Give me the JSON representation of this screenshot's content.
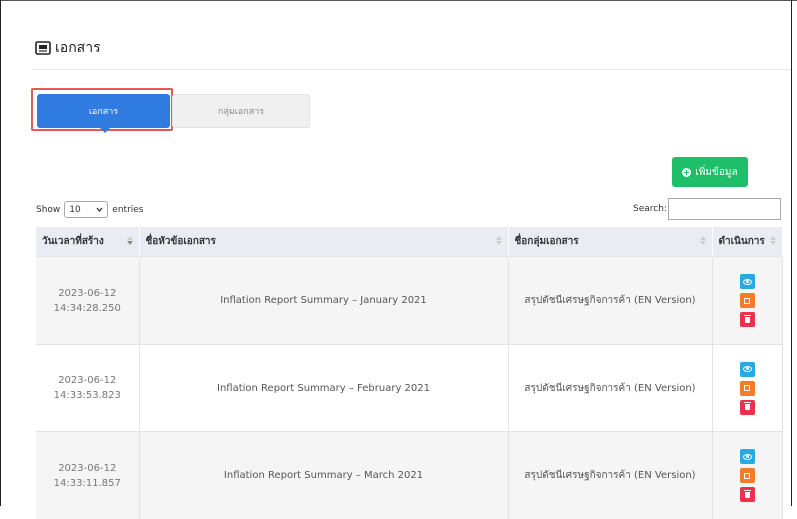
{
  "page": {
    "title": "เอกสาร",
    "title_icon": "document-image-icon"
  },
  "tabs": [
    {
      "label": "เอกสาร",
      "active": true
    },
    {
      "label": "กลุ่มเอกสาร",
      "active": false
    }
  ],
  "toolbar": {
    "add_label": "เพิ่มข้อมูล",
    "show_prefix": "Show",
    "entries_value": "10",
    "entries_suffix": "entries",
    "search_label": "Search:",
    "search_value": ""
  },
  "table": {
    "columns": [
      "วันเวลาที่สร้าง",
      "ชื่อหัวข้อเอกสาร",
      "ชื่อกลุ่มเอกสาร",
      "ดำเนินการ"
    ],
    "rows": [
      {
        "date": "2023-06-12",
        "time": "14:34:28.250",
        "title": "Inflation Report Summary – January 2021",
        "group": "สรุปดัชนีเศรษฐกิจการค้า (EN Version)"
      },
      {
        "date": "2023-06-12",
        "time": "14:33:53.823",
        "title": "Inflation Report Summary – February 2021",
        "group": "สรุปดัชนีเศรษฐกิจการค้า (EN Version)"
      },
      {
        "date": "2023-06-12",
        "time": "14:33:11.857",
        "title": "Inflation Report Summary – March 2021",
        "group": "สรุปดัชนีเศรษฐกิจการค้า (EN Version)"
      }
    ]
  },
  "colors": {
    "primary": "#2f7be0",
    "success": "#1fbf6a",
    "info": "#27a9e1",
    "warning": "#f37b2a",
    "danger": "#e8334a",
    "highlight_ring": "#e05a5a"
  }
}
